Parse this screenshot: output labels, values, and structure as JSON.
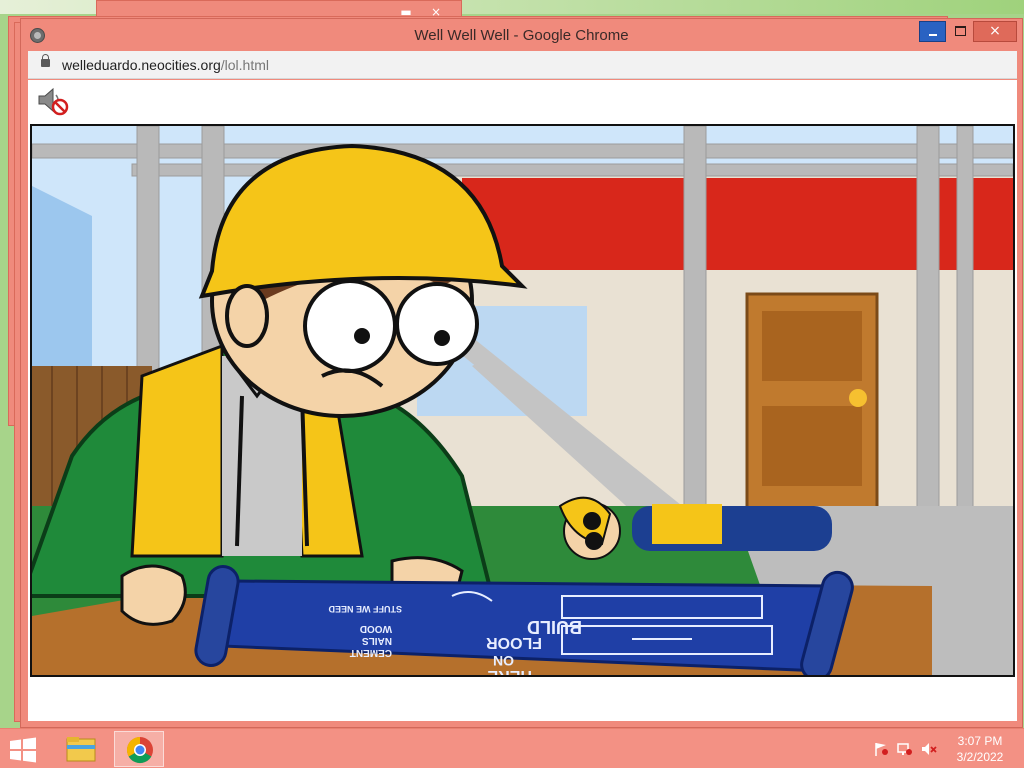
{
  "window": {
    "title": "Well Well Well - Google Chrome",
    "controls": {
      "minimize": "minimize",
      "maximize": "maximize",
      "close": "×"
    }
  },
  "background_windows": {
    "close_label": "×"
  },
  "address_bar": {
    "host": "welleduardo.neocities.org",
    "path": "/lol.html"
  },
  "page": {
    "mute_icon": "speaker-muted-icon"
  },
  "video": {
    "blueprint_texts": [
      "BUILD",
      "FLOOR",
      "ON",
      "HERE",
      "WOOD",
      "NAILS",
      "CEMENT",
      "STUFF WE NEED"
    ]
  },
  "taskbar": {
    "clock_time": "3:07 PM",
    "clock_date": "3/2/2022",
    "items": [
      "start-button",
      "file-explorer",
      "google-chrome"
    ]
  },
  "colors": {
    "window_frame": "#f08a7c",
    "taskbar": "#f39184",
    "minimize_button": "#2a62c2",
    "hardhat": "#f5c518",
    "hoodie": "#1f8a3a",
    "blueprint": "#1f3fa6"
  }
}
